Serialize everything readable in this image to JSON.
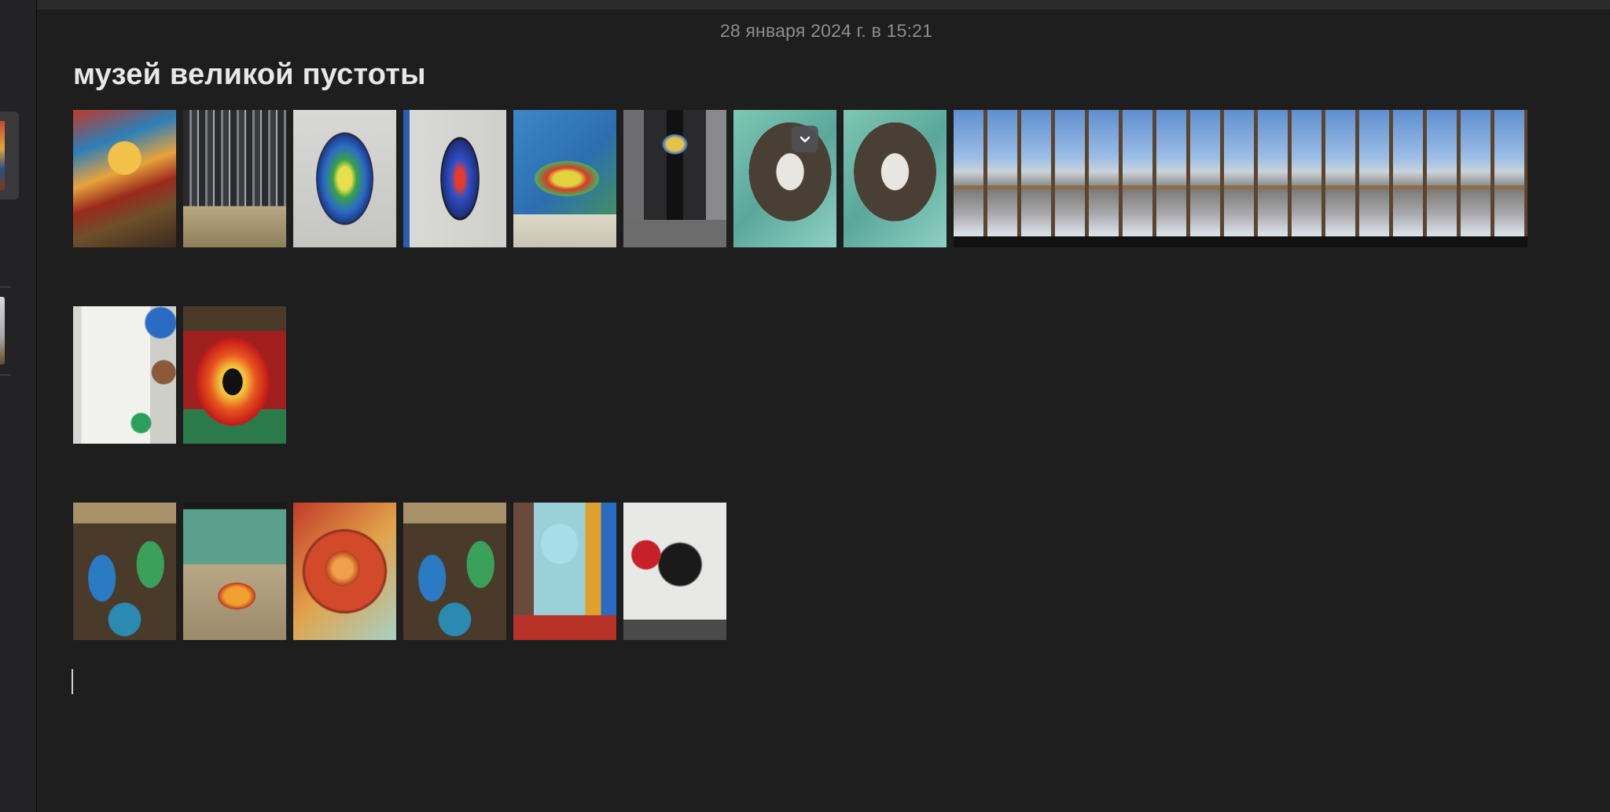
{
  "note": {
    "date": "28 января 2024 г. в 15:21",
    "title": "музей великой пустоты"
  },
  "attachments": {
    "row1": [
      "photo",
      "photo",
      "photo",
      "photo",
      "photo",
      "photo",
      "photo",
      "photo",
      "panorama"
    ],
    "row2": [
      "photo",
      "photo"
    ],
    "row3": [
      "photo",
      "photo",
      "photo",
      "photo",
      "photo",
      "photo"
    ]
  },
  "icons": {
    "attachment_menu": "chevron-down-icon"
  },
  "colors": {
    "background": "#1e1e1e",
    "title": "#e8e8ea",
    "date": "#8d8d92"
  }
}
